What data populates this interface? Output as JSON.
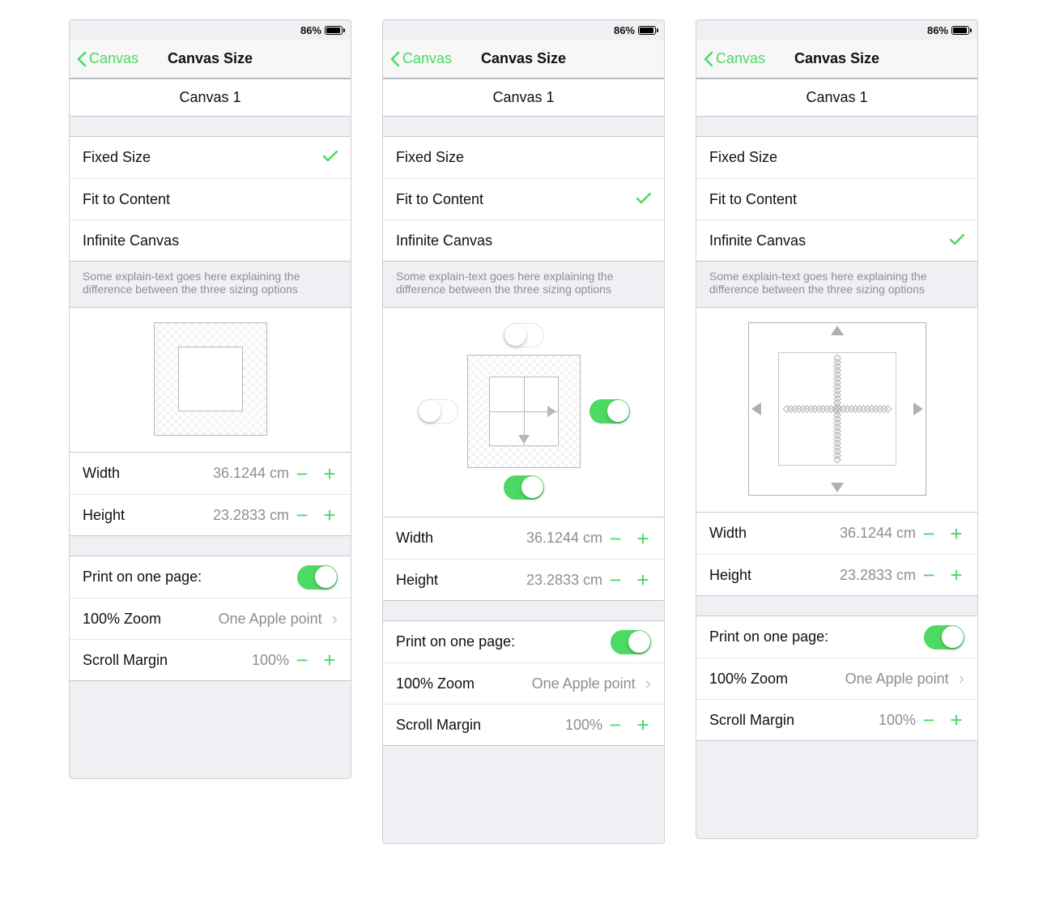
{
  "status": {
    "battery_text": "86%",
    "battery_pct": 86
  },
  "nav": {
    "back_label": "Canvas",
    "title": "Canvas Size"
  },
  "canvas_name": "Canvas 1",
  "size_modes": {
    "fixed": "Fixed Size",
    "fit": "Fit to Content",
    "infinite": "Infinite Canvas"
  },
  "explain_text": "Some explain-text goes here explaining the difference between the three sizing options",
  "dimensions": {
    "width_label": "Width",
    "width_value": "36.1244 cm",
    "height_label": "Height",
    "height_value": "23.2833 cm"
  },
  "print": {
    "one_page_label": "Print on one page:",
    "one_page_on": true
  },
  "zoom": {
    "label": "100% Zoom",
    "value": "One Apple point"
  },
  "scroll_margin": {
    "label": "Scroll Margin",
    "value": "100%"
  },
  "fit_toggles": {
    "top": false,
    "left": false,
    "right": true,
    "bottom": true
  },
  "panels": [
    {
      "id": "fixed",
      "selected": "fixed"
    },
    {
      "id": "fit",
      "selected": "fit"
    },
    {
      "id": "infinite",
      "selected": "infinite"
    }
  ],
  "colors": {
    "accent": "#4cd964",
    "secondary_text": "#8e8e93"
  }
}
